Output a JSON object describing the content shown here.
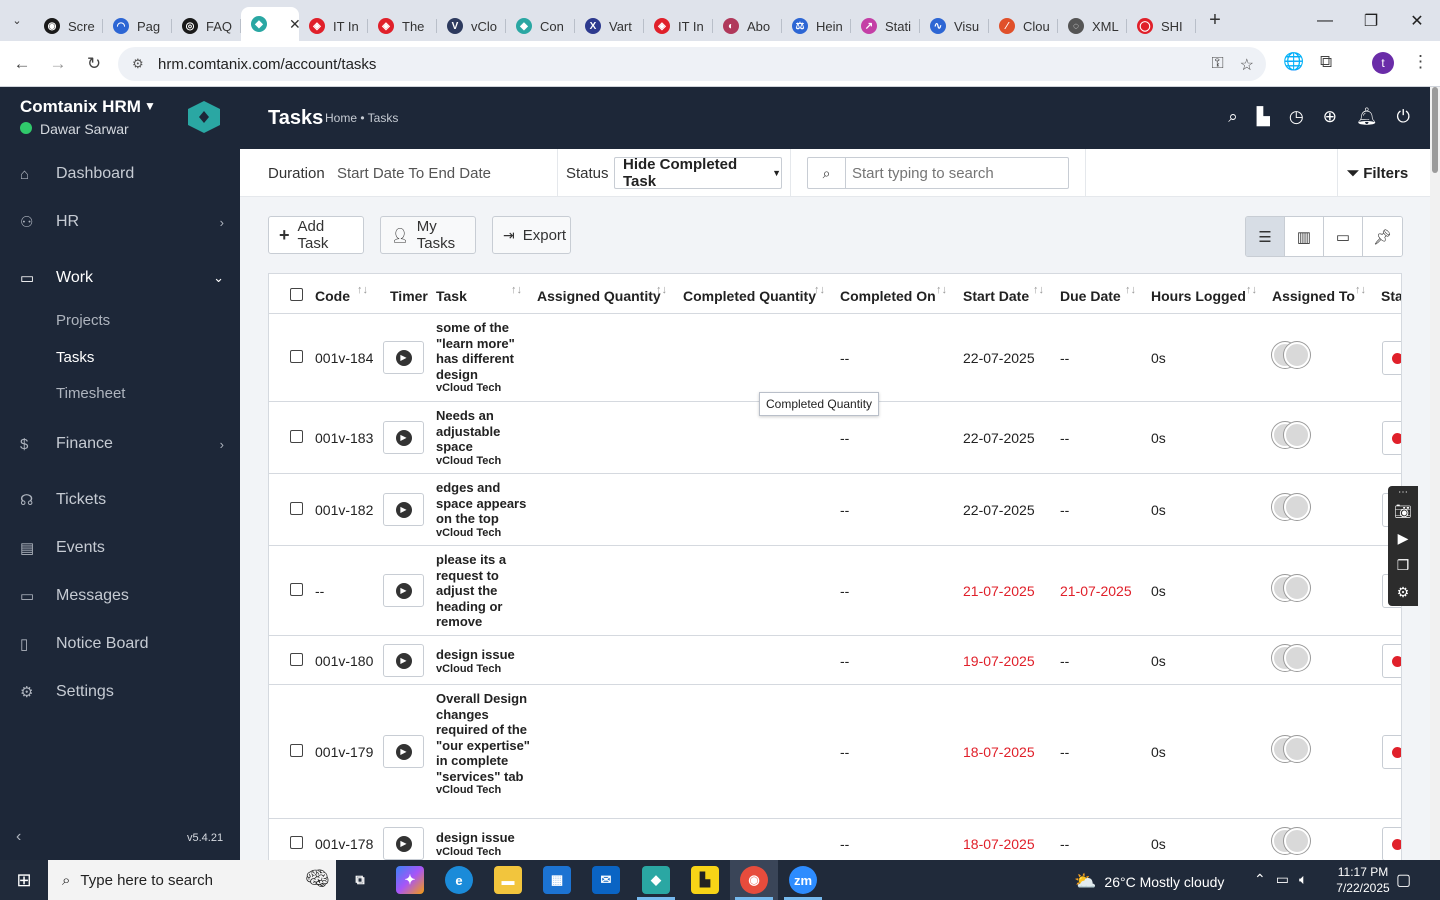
{
  "browser": {
    "tabs": [
      {
        "label": "Scre",
        "color": "#1a1a1a",
        "glyph": "◉"
      },
      {
        "label": "Pag",
        "color": "#2d66d4",
        "glyph": "◠"
      },
      {
        "label": "FAQ",
        "color": "#1a1a1a",
        "glyph": "◎"
      },
      {
        "label": "",
        "color": "#2aa7a3",
        "glyph": "◆"
      },
      {
        "label": "IT In",
        "color": "#e0202a",
        "glyph": "◈"
      },
      {
        "label": "The",
        "color": "#e0202a",
        "glyph": "◈"
      },
      {
        "label": "vClo",
        "color": "#2d3a5e",
        "glyph": "V"
      },
      {
        "label": "Con",
        "color": "#2aa7a3",
        "glyph": "◆"
      },
      {
        "label": "Vart",
        "color": "#2d3a8e",
        "glyph": "X"
      },
      {
        "label": "IT In",
        "color": "#e0202a",
        "glyph": "◈"
      },
      {
        "label": "Abo",
        "color": "#b0395b",
        "glyph": "◐"
      },
      {
        "label": "Hein",
        "color": "#2d66d4",
        "glyph": "⚖"
      },
      {
        "label": "Stati",
        "color": "#c43fa6",
        "glyph": "↗"
      },
      {
        "label": "Visu",
        "color": "#2d66d4",
        "glyph": "∿"
      },
      {
        "label": "Clou",
        "color": "#e0502a",
        "glyph": "⁄"
      },
      {
        "label": "XML",
        "color": "#555",
        "glyph": "◌"
      },
      {
        "label": "SHI",
        "color": "#e0202a",
        "glyph": "◯"
      }
    ],
    "url": "hrm.comtanix.com/account/tasks",
    "profile_initial": "t"
  },
  "sidebar": {
    "brand": "Comtanix HRM",
    "user": "Dawar Sarwar",
    "items": [
      {
        "label": "Dashboard",
        "icon": "home-icon",
        "glyph": "⌂"
      },
      {
        "label": "HR",
        "icon": "people-icon",
        "glyph": "👥"
      },
      {
        "label": "Work",
        "icon": "briefcase-icon",
        "glyph": "💼"
      },
      {
        "label": "Finance",
        "icon": "dollar-icon",
        "glyph": "$"
      },
      {
        "label": "Tickets",
        "icon": "headset-icon",
        "glyph": "🎧"
      },
      {
        "label": "Events",
        "icon": "calendar-icon",
        "glyph": "📅"
      },
      {
        "label": "Messages",
        "icon": "message-icon",
        "glyph": "💬"
      },
      {
        "label": "Notice Board",
        "icon": "clipboard-icon",
        "glyph": "📋"
      },
      {
        "label": "Settings",
        "icon": "gear-icon",
        "glyph": "⚙"
      }
    ],
    "sub_items": [
      "Projects",
      "Tasks",
      "Timesheet"
    ],
    "version": "v5.4.21"
  },
  "header": {
    "title": "Tasks",
    "breadcrumb": "Home • Tasks"
  },
  "filters": {
    "duration_label": "Duration",
    "duration_value": "Start Date To End Date",
    "status_label": "Status",
    "status_value": "Hide Completed Task",
    "search_placeholder": "Start typing to search",
    "filters_label": "Filters"
  },
  "toolbar": {
    "add_task": "Add Task",
    "my_tasks": "My Tasks",
    "export": "Export"
  },
  "table": {
    "columns": [
      "Code",
      "Timer",
      "Task",
      "Assigned Quantity",
      "Completed Quantity",
      "Completed On",
      "Start Date",
      "Due Date",
      "Hours Logged",
      "Assigned To",
      "Sta"
    ],
    "tooltip": "Completed Quantity",
    "rows": [
      {
        "code": "001v-184",
        "task": "some of the \"learn more\" has different design",
        "project": "vCloud Tech",
        "completed_on": "--",
        "start": "22-07-2025",
        "due": "--",
        "hours": "0s",
        "start_red": false,
        "due_red": false
      },
      {
        "code": "001v-183",
        "task": "Needs an adjustable space",
        "project": "vCloud Tech",
        "completed_on": "--",
        "start": "22-07-2025",
        "due": "--",
        "hours": "0s",
        "start_red": false,
        "due_red": false
      },
      {
        "code": "001v-182",
        "task": "edges and space appears on the top",
        "project": "vCloud Tech",
        "completed_on": "--",
        "start": "22-07-2025",
        "due": "--",
        "hours": "0s",
        "start_red": false,
        "due_red": false
      },
      {
        "code": "--",
        "task": "please its a request to adjust the heading or remove",
        "project": "",
        "completed_on": "--",
        "start": "21-07-2025",
        "due": "21-07-2025",
        "hours": "0s",
        "start_red": true,
        "due_red": true
      },
      {
        "code": "001v-180",
        "task": "design issue",
        "project": "vCloud Tech",
        "completed_on": "--",
        "start": "19-07-2025",
        "due": "--",
        "hours": "0s",
        "start_red": true,
        "due_red": false
      },
      {
        "code": "001v-179",
        "task": "Overall Design changes required of the \"our expertise\" in complete \"services\" tab",
        "project": "vCloud Tech",
        "completed_on": "--",
        "start": "18-07-2025",
        "due": "--",
        "hours": "0s",
        "start_red": true,
        "due_red": false
      },
      {
        "code": "001v-178",
        "task": "design issue",
        "project": "vCloud Tech",
        "completed_on": "--",
        "start": "18-07-2025",
        "due": "--",
        "hours": "0s",
        "start_red": true,
        "due_red": false
      }
    ]
  },
  "taskbar": {
    "search_placeholder": "Type here to search",
    "weather": "26°C  Mostly cloudy",
    "time": "11:17 PM",
    "date": "7/22/2025"
  }
}
